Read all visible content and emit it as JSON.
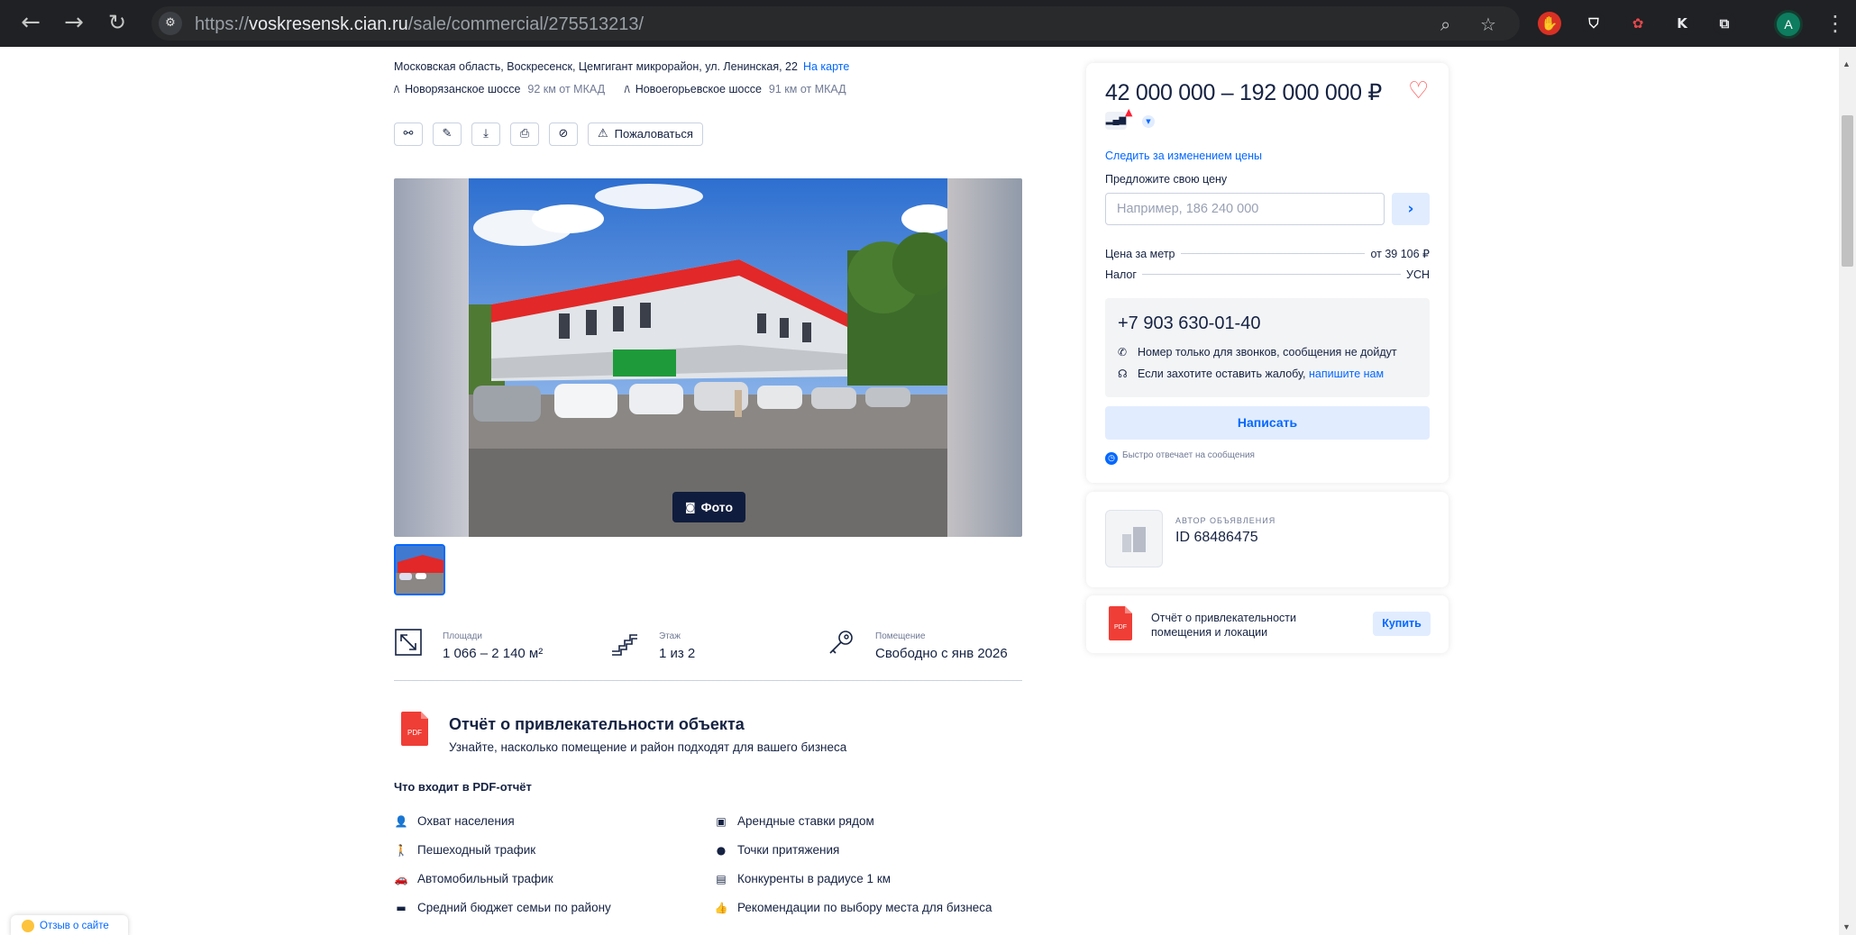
{
  "browser": {
    "url_prefix": "https://",
    "url_host": "voskresensk.cian.ru",
    "url_path": "/sale/commercial/275513213/",
    "profile_initial": "A",
    "ext_k_label": "K",
    "back_icon": "arrow-left-icon",
    "forward_icon": "arrow-right-icon",
    "reload_icon": "reload-icon"
  },
  "listing": {
    "address": "Московская область, Воскресенск, Цемгигант микрорайон, ул. Ленинская, 22",
    "map_link": "На карте",
    "highways": [
      {
        "name": "Новорязанское шоссе",
        "distance": "92 км от МКАД"
      },
      {
        "name": "Новоегорьевское шоссе",
        "distance": "91 км от МКАД"
      }
    ],
    "report_button": "Пожаловаться",
    "photo_button": "Фото",
    "features": [
      {
        "label": "Площади",
        "value": "1 066 – 2 140 м²",
        "icon": "area-icon"
      },
      {
        "label": "Этаж",
        "value": "1 из 2",
        "icon": "stairs-icon"
      },
      {
        "label": "Помещение",
        "value": "Свободно с янв 2026",
        "icon": "key-icon"
      }
    ]
  },
  "attractiveness_report": {
    "pdf_badge": "PDF",
    "title": "Отчёт о привлекательности объекта",
    "subtitle": "Узнайте, насколько помещение и район подходят для вашего бизнеса",
    "includes_title": "Что входит в PDF-отчёт",
    "items_left": [
      "Охват населения",
      "Пешеходный трафик",
      "Автомобильный трафик",
      "Средний бюджет семьи по району"
    ],
    "items_right": [
      "Арендные ставки рядом",
      "Точки притяжения",
      "Конкуренты в радиусе 1 км",
      "Рекомендации по выбору места для бизнеса"
    ]
  },
  "price_card": {
    "price": "42 000 000 – 192 000 000 ₽",
    "follow_price": "Следить за изменением цены",
    "offer_label": "Предложите свою цену",
    "offer_placeholder": "Например, 186 240 000",
    "price_per_meter_label": "Цена за метр",
    "price_per_meter_value": "от 39 106 ₽",
    "tax_label": "Налог",
    "tax_value": "УСН",
    "phone": "+7 903 630-01-40",
    "calls_only": "Номер только для звонков, сообщения не дойдут",
    "complaint_text": "Если захотите оставить жалобу,",
    "complaint_link": "напишите нам",
    "write_button": "Написать",
    "fast_reply": "Быстро отвечает на сообщения"
  },
  "author_card": {
    "label": "АВТОР ОБЪЯВЛЕНИЯ",
    "id": "ID 68486475"
  },
  "buy_card": {
    "pdf_badge": "PDF",
    "text": "Отчёт о привлекательности помещения и локации",
    "button": "Купить"
  },
  "feedback": {
    "label": "Отзыв о сайте"
  },
  "colors": {
    "accent": "#0468ff",
    "text": "#152242",
    "heart": "#ff5050",
    "pdf": "#ef3e36"
  }
}
